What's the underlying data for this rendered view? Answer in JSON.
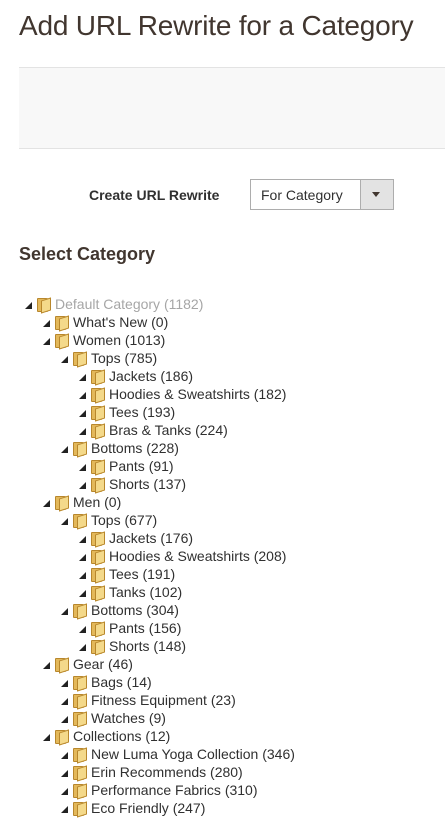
{
  "page": {
    "title": "Add URL Rewrite for a Category"
  },
  "form": {
    "create_label": "Create URL Rewrite",
    "create_value": "For Category"
  },
  "section": {
    "select_category_title": "Select Category"
  },
  "tree": {
    "items": [
      {
        "label": "Default Category (1182)",
        "depth": 0,
        "muted": true
      },
      {
        "label": "What's New (0)",
        "depth": 1
      },
      {
        "label": "Women (1013)",
        "depth": 1
      },
      {
        "label": "Tops (785)",
        "depth": 2
      },
      {
        "label": "Jackets (186)",
        "depth": 3
      },
      {
        "label": "Hoodies & Sweatshirts (182)",
        "depth": 3
      },
      {
        "label": "Tees (193)",
        "depth": 3
      },
      {
        "label": "Bras & Tanks (224)",
        "depth": 3
      },
      {
        "label": "Bottoms (228)",
        "depth": 2
      },
      {
        "label": "Pants (91)",
        "depth": 3
      },
      {
        "label": "Shorts (137)",
        "depth": 3
      },
      {
        "label": "Men (0)",
        "depth": 1
      },
      {
        "label": "Tops (677)",
        "depth": 2
      },
      {
        "label": "Jackets (176)",
        "depth": 3
      },
      {
        "label": "Hoodies & Sweatshirts (208)",
        "depth": 3
      },
      {
        "label": "Tees (191)",
        "depth": 3
      },
      {
        "label": "Tanks (102)",
        "depth": 3
      },
      {
        "label": "Bottoms (304)",
        "depth": 2
      },
      {
        "label": "Pants (156)",
        "depth": 3
      },
      {
        "label": "Shorts (148)",
        "depth": 3
      },
      {
        "label": "Gear (46)",
        "depth": 1
      },
      {
        "label": "Bags (14)",
        "depth": 2
      },
      {
        "label": "Fitness Equipment (23)",
        "depth": 2
      },
      {
        "label": "Watches (9)",
        "depth": 2
      },
      {
        "label": "Collections (12)",
        "depth": 1
      },
      {
        "label": "New Luma Yoga Collection (346)",
        "depth": 2
      },
      {
        "label": "Erin Recommends (280)",
        "depth": 2
      },
      {
        "label": "Performance Fabrics (310)",
        "depth": 2
      },
      {
        "label": "Eco Friendly (247)",
        "depth": 2
      }
    ]
  },
  "icons": {
    "toggle": "expanded-triangle-icon",
    "node": "folder-icon"
  }
}
